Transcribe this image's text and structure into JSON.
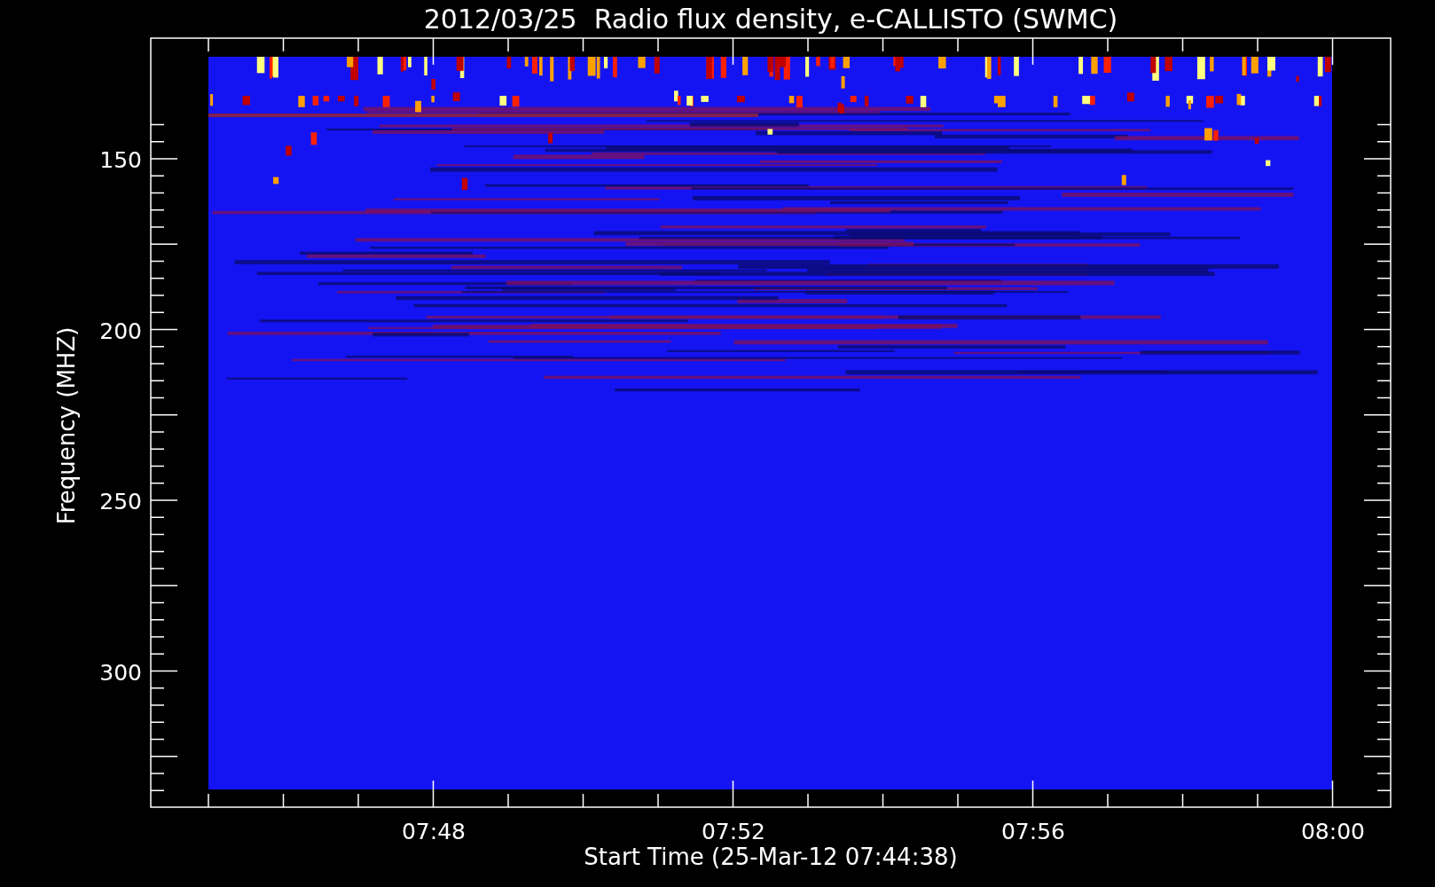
{
  "chart_title": "2012/03/25  Radio flux density, e-CALLISTO (SWMC)",
  "y_axis": {
    "label": "Frequency (MHZ)",
    "ticks": [
      "150",
      "200",
      "250",
      "300"
    ]
  },
  "x_axis": {
    "label": "Start Time (25-Mar-12 07:44:38)",
    "ticks": [
      "07:48",
      "07:52",
      "07:56",
      "08:00"
    ]
  }
}
